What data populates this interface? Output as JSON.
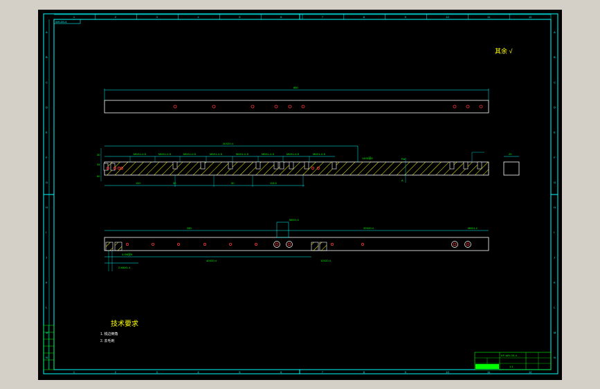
{
  "colors": {
    "background": "#000000",
    "frame": "#00ffff",
    "dimension": "#00ff00",
    "hatch": "#ffff00",
    "hole": "#ff3333",
    "title_block": "#00ff00",
    "outer": "#d4d0c8"
  },
  "drawing": {
    "corner_code": "WH-3S-4",
    "column_numbers": [
      "1",
      "2",
      "3",
      "4",
      "5",
      "6",
      "7",
      "8",
      "9",
      "10",
      "11",
      "12"
    ],
    "row_letters": [
      "A",
      "B",
      "C",
      "D",
      "E",
      "F",
      "G",
      "H",
      "I",
      "J",
      "K",
      "L",
      "M",
      "N"
    ],
    "roughness_note": "其余 √",
    "view1": {
      "overall_dim": "880"
    },
    "view2": {
      "thread_labels": [
        "M6X1.4↓5",
        "M6X1.4↓5",
        "M6X1.4↓5",
        "M6X1.4↓5",
        "M6X1.4↓5",
        "M6X1.4↓5",
        "M6X1.4↓5",
        "M6X1.4↓5"
      ],
      "top_dim": "30X20.4",
      "left_dims": [
        "30",
        "34",
        "50"
      ],
      "bottom_dims": [
        "100",
        "50",
        "50",
        "115.5"
      ],
      "right_note": "14X4深6",
      "side_dim": "20"
    },
    "view3": {
      "left_dim": "280",
      "right_dim": "20X20.4",
      "top_note": "M6X1.4",
      "right_note": "M6X1.4",
      "bottom_dims": [
        "4-Φ8深5",
        "40X20.4",
        "10X20.4",
        "2-M6X1.4"
      ]
    },
    "tech_requirements": {
      "title": "技术要求",
      "items": [
        "1. 锐边倒角",
        "2. 去毛刺"
      ]
    },
    "title_block": {
      "part_name": "KF-WH-3S-4",
      "scale": "1:1"
    }
  }
}
